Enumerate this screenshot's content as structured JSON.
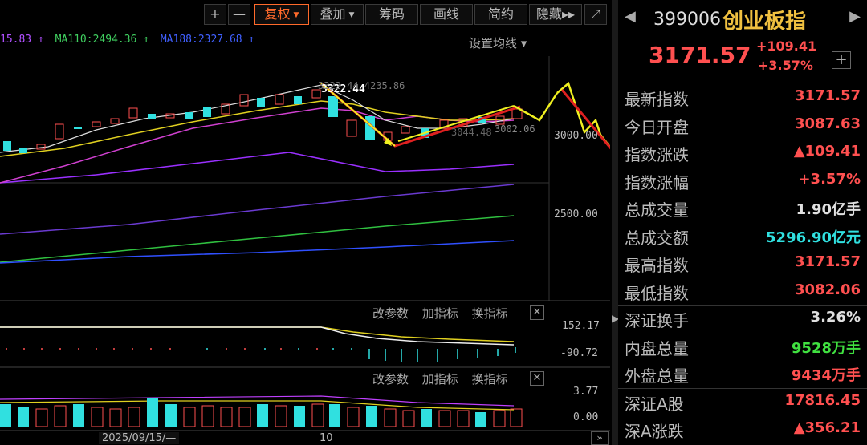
{
  "toolbar": {
    "plus": "+",
    "minus": "—",
    "restore_rights": "复权",
    "overlay": "叠加",
    "chip": "筹码",
    "draw_line": "画线",
    "brief": "简约",
    "hide": "隐藏",
    "hide_arrows": "▸▸",
    "fullscreen_icon": "fullscreen-icon"
  },
  "ma_legend": [
    {
      "text": "15.83 ↑",
      "color": "#b050ff"
    },
    {
      "text": "MA110:2494.36 ↑",
      "color": "#40d060"
    },
    {
      "text": "MA188:2327.68 ↑",
      "color": "#4060ff"
    }
  ],
  "ma_settings": "设置均线 ▾",
  "price_axis": {
    "top_label": "3000.00",
    "bottom_label": "2500.00"
  },
  "annotations": {
    "high_label": "3322.44",
    "high_label_dim": "3322.44 4235.86",
    "low_label": "3002.06",
    "low_label_dim": "3044.48"
  },
  "indicator1": {
    "change_params": "改参数",
    "add_indicator": "加指标",
    "switch_indicator": "换指标",
    "close": "✕",
    "upper_value": "152.17",
    "lower_value": "-90.72"
  },
  "indicator2": {
    "change_params": "改参数",
    "add_indicator": "加指标",
    "switch_indicator": "换指标",
    "close": "✕",
    "upper_value": "3.77",
    "lower_value": "0.00"
  },
  "xaxis": {
    "date": "2025/09/15/—",
    "mid": "10",
    "scroll": "»"
  },
  "quote": {
    "code": "399006",
    "name": "创业板指",
    "price": "3171.57",
    "change": "+109.41",
    "change_pct": "+3.57%",
    "add": "+",
    "rows": [
      {
        "label": "最新指数",
        "value": "3171.57",
        "color": "#ff5050"
      },
      {
        "label": "今日开盘",
        "value": "3087.63",
        "color": "#ff5050"
      },
      {
        "label": "指数涨跌",
        "value": "▲109.41",
        "color": "#ff5050"
      },
      {
        "label": "指数涨幅",
        "value": "+3.57%",
        "color": "#ff5050"
      },
      {
        "label": "总成交量",
        "value": "1.90亿手",
        "color": "#e0e0e0"
      },
      {
        "label": "总成交额",
        "value": "5296.90亿元",
        "color": "#30e0e0"
      },
      {
        "label": "最高指数",
        "value": "3171.57",
        "color": "#ff5050"
      },
      {
        "label": "最低指数",
        "value": "3082.06",
        "color": "#ff5050"
      },
      {
        "label": "深证换手",
        "value": "3.26%",
        "color": "#e0e0e0"
      },
      {
        "label": "内盘总量",
        "value": "9528万手",
        "color": "#40e040"
      },
      {
        "label": "外盘总量",
        "value": "9434万手",
        "color": "#ff5050"
      },
      {
        "label": "深证A股",
        "value": "17816.45",
        "color": "#ff5050"
      },
      {
        "label": "深A涨跌",
        "value": "▲356.21",
        "color": "#ff5050"
      }
    ]
  }
}
